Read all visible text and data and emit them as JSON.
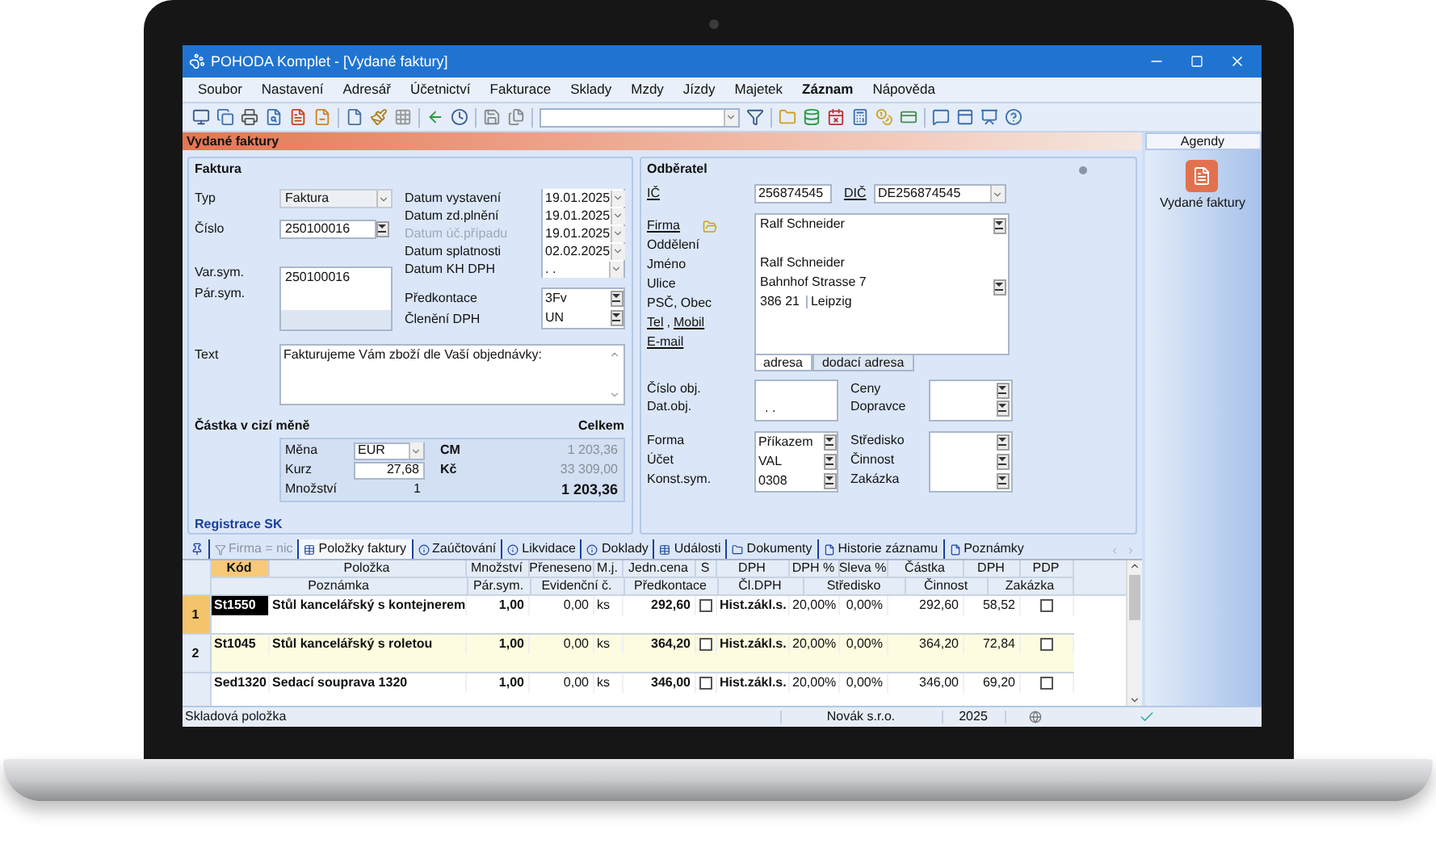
{
  "window": {
    "title": "POHODA Komplet - [Vydané faktury]"
  },
  "menu": [
    {
      "label": "Soubor",
      "bold": false
    },
    {
      "label": "Nastavení",
      "bold": false
    },
    {
      "label": "Adresář",
      "bold": false
    },
    {
      "label": "Účetnictví",
      "bold": false
    },
    {
      "label": "Fakturace",
      "bold": false
    },
    {
      "label": "Sklady",
      "bold": false
    },
    {
      "label": "Mzdy",
      "bold": false
    },
    {
      "label": "Jízdy",
      "bold": false
    },
    {
      "label": "Majetek",
      "bold": false
    },
    {
      "label": "Záznam",
      "bold": true
    },
    {
      "label": "Nápověda",
      "bold": false
    }
  ],
  "agenda_title": "Vydané faktury",
  "invoice": {
    "title": "Faktura",
    "type": {
      "label": "Typ",
      "value": "Faktura"
    },
    "number": {
      "label": "Číslo",
      "value": "250100016"
    },
    "var_sym": {
      "label": "Var.sym.",
      "value": "250100016"
    },
    "par_sym": {
      "label": "Pár.sym."
    },
    "dates": [
      {
        "label": "Datum vystavení",
        "value": "19.01.2025",
        "disabled": false
      },
      {
        "label": "Datum zd.plnění",
        "value": "19.01.2025",
        "disabled": false
      },
      {
        "label": "Datum úč.případu",
        "value": "19.01.2025",
        "disabled": true
      },
      {
        "label": "Datum splatnosti",
        "value": "02.02.2025",
        "disabled": false
      },
      {
        "label": "Datum KH DPH",
        "value": ". .",
        "disabled": false
      }
    ],
    "accounting": [
      {
        "label": "Předkontace",
        "value": "3Fv"
      },
      {
        "label": "Členění DPH",
        "value": "UN"
      }
    ],
    "text": {
      "label": "Text",
      "value": "Fakturujeme Vám zboží dle Vaší objednávky:"
    },
    "foreign": {
      "title": "Částka v cizí měně",
      "total_heading": "Celkem",
      "rows": [
        {
          "label": "Měna",
          "value": "EUR",
          "kind": "select",
          "total_label": "CM",
          "total": "1 203,36",
          "emphasized": false
        },
        {
          "label": "Kurz",
          "value": "27,68",
          "kind": "input",
          "total_label": "Kč",
          "total": "33 309,00",
          "emphasized": false
        },
        {
          "label": "Množství",
          "value": "1",
          "kind": "plain",
          "total": "1 203,36",
          "emphasized": true
        }
      ]
    },
    "registration": "Registrace SK"
  },
  "customer": {
    "title": "Odběratel",
    "ic": {
      "label": "IČ",
      "value": "256874545"
    },
    "dic": {
      "label": "DIČ",
      "value": "DE256874545"
    },
    "address_labels": [
      [
        {
          "text": "Firma",
          "link": true
        }
      ],
      [
        {
          "text": "Oddělení",
          "link": false
        }
      ],
      [
        {
          "text": "Jméno",
          "link": false
        }
      ],
      [
        {
          "text": "Ulice",
          "link": false
        }
      ],
      [
        {
          "text": "PSČ, Obec",
          "link": false
        }
      ],
      [
        {
          "text": "Tel",
          "link": true
        },
        {
          "text": ",",
          "link": false
        },
        {
          "text": "Mobil",
          "link": true
        }
      ],
      [
        {
          "text": "E-mail",
          "link": true
        }
      ]
    ],
    "address": {
      "company": "Ralf Schneider",
      "name": "Ralf Schneider",
      "street": "Bahnhof Strasse 7",
      "zip": "386 21",
      "city": "Leipzig"
    },
    "address_tabs": [
      {
        "label": "adresa",
        "selected": true
      },
      {
        "label": "dodací adresa",
        "selected": false
      }
    ],
    "order_labels": [
      "Číslo obj.",
      "Dat.obj."
    ],
    "order_date": ". .",
    "delivery_labels": [
      "Ceny",
      "Dopravce"
    ],
    "payment": [
      {
        "label": "Forma",
        "value": "Příkazem"
      },
      {
        "label": "Účet",
        "value": "VAL"
      },
      {
        "label": "Konst.sym.",
        "value": "0308"
      }
    ],
    "cost_labels": [
      "Středisko",
      "Činnost",
      "Zakázka"
    ]
  },
  "tabs": [
    {
      "label": "Firma = nic",
      "selected": false,
      "disabled": true
    },
    {
      "label": "Položky faktury",
      "selected": true,
      "disabled": false
    },
    {
      "label": "Zaúčtování",
      "selected": false,
      "disabled": false
    },
    {
      "label": "Likvidace",
      "selected": false,
      "disabled": false
    },
    {
      "label": "Doklady",
      "selected": false,
      "disabled": false
    },
    {
      "label": "Události",
      "selected": false,
      "disabled": false
    },
    {
      "label": "Dokumenty",
      "selected": false,
      "disabled": false
    },
    {
      "label": "Historie záznamu",
      "selected": false,
      "disabled": false
    },
    {
      "label": "Poznámky",
      "selected": false,
      "disabled": false
    }
  ],
  "table": {
    "columns": [
      {
        "label": "Kód",
        "sorted": true
      },
      {
        "label": "Položka",
        "sorted": false
      },
      {
        "label": "Množství",
        "sorted": false
      },
      {
        "label": "Přeneseno",
        "sorted": false
      },
      {
        "label": "M.j.",
        "sorted": false
      },
      {
        "label": "Jedn.cena",
        "sorted": false
      },
      {
        "label": "S",
        "sorted": false
      },
      {
        "label": "DPH",
        "sorted": false
      },
      {
        "label": "DPH %",
        "sorted": false
      },
      {
        "label": "Sleva %",
        "sorted": false
      },
      {
        "label": "Částka",
        "sorted": false
      },
      {
        "label": "DPH",
        "sorted": false
      },
      {
        "label": "PDP",
        "sorted": false
      }
    ],
    "subcolumns": [
      "Poznámka",
      "Pár.sym.",
      "Evidenční č.",
      "Předkontace",
      "Čl.DPH",
      "Středisko",
      "Činnost",
      "Zakázka"
    ],
    "rows": [
      {
        "number": "1",
        "selected": true,
        "code": "St1550",
        "name": "Stůl kancelářský s kontejnerem",
        "quantity": "1,00",
        "transferred": "0,00",
        "unit": "ks",
        "unit_price": "292,60",
        "s_checked": false,
        "vat": "Hist.zákl.s.",
        "vat_rate": "20,00%",
        "discount": "0,00%",
        "amount": "292,60",
        "vat_amount": "58,52",
        "pdp_checked": false
      },
      {
        "number": "2",
        "selected": false,
        "code": "St1045",
        "name": "Stůl kancelářský s roletou",
        "quantity": "1,00",
        "transferred": "0,00",
        "unit": "ks",
        "unit_price": "364,20",
        "s_checked": false,
        "vat": "Hist.zákl.s.",
        "vat_rate": "20,00%",
        "discount": "0,00%",
        "amount": "364,20",
        "vat_amount": "72,84",
        "pdp_checked": false
      },
      {
        "selected": false,
        "code": "Sed1320",
        "name": "Sedací souprava 1320",
        "quantity": "1,00",
        "transferred": "0,00",
        "unit": "ks",
        "unit_price": "346,00",
        "s_checked": false,
        "vat": "Hist.zákl.s.",
        "vat_rate": "20,00%",
        "discount": "0,00%",
        "amount": "346,00",
        "vat_amount": "69,20",
        "pdp_checked": false
      }
    ]
  },
  "agendas": {
    "title": "Agendy",
    "items": [
      {
        "label": "Vydané faktury"
      }
    ]
  },
  "status_bar": {
    "hint": "Skladová položka",
    "company": "Novák s.r.o.",
    "year": "2025"
  }
}
